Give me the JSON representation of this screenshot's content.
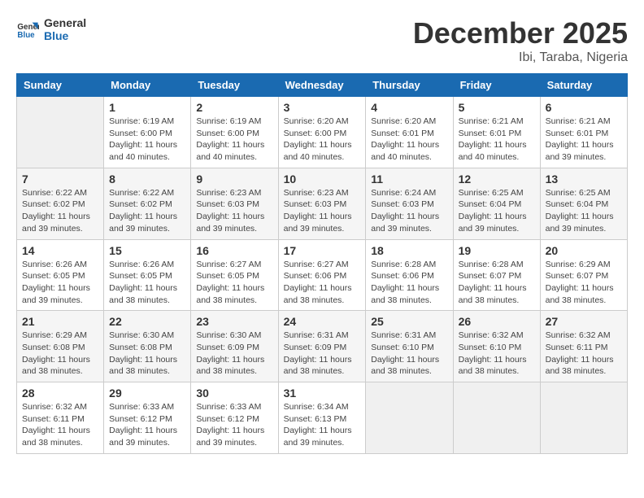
{
  "logo": {
    "line1": "General",
    "line2": "Blue"
  },
  "title": "December 2025",
  "subtitle": "Ibi, Taraba, Nigeria",
  "days_header": [
    "Sunday",
    "Monday",
    "Tuesday",
    "Wednesday",
    "Thursday",
    "Friday",
    "Saturday"
  ],
  "weeks": [
    [
      {
        "day": "",
        "info": ""
      },
      {
        "day": "1",
        "info": "Sunrise: 6:19 AM\nSunset: 6:00 PM\nDaylight: 11 hours\nand 40 minutes."
      },
      {
        "day": "2",
        "info": "Sunrise: 6:19 AM\nSunset: 6:00 PM\nDaylight: 11 hours\nand 40 minutes."
      },
      {
        "day": "3",
        "info": "Sunrise: 6:20 AM\nSunset: 6:00 PM\nDaylight: 11 hours\nand 40 minutes."
      },
      {
        "day": "4",
        "info": "Sunrise: 6:20 AM\nSunset: 6:01 PM\nDaylight: 11 hours\nand 40 minutes."
      },
      {
        "day": "5",
        "info": "Sunrise: 6:21 AM\nSunset: 6:01 PM\nDaylight: 11 hours\nand 40 minutes."
      },
      {
        "day": "6",
        "info": "Sunrise: 6:21 AM\nSunset: 6:01 PM\nDaylight: 11 hours\nand 39 minutes."
      }
    ],
    [
      {
        "day": "7",
        "info": "Sunrise: 6:22 AM\nSunset: 6:02 PM\nDaylight: 11 hours\nand 39 minutes."
      },
      {
        "day": "8",
        "info": "Sunrise: 6:22 AM\nSunset: 6:02 PM\nDaylight: 11 hours\nand 39 minutes."
      },
      {
        "day": "9",
        "info": "Sunrise: 6:23 AM\nSunset: 6:03 PM\nDaylight: 11 hours\nand 39 minutes."
      },
      {
        "day": "10",
        "info": "Sunrise: 6:23 AM\nSunset: 6:03 PM\nDaylight: 11 hours\nand 39 minutes."
      },
      {
        "day": "11",
        "info": "Sunrise: 6:24 AM\nSunset: 6:03 PM\nDaylight: 11 hours\nand 39 minutes."
      },
      {
        "day": "12",
        "info": "Sunrise: 6:25 AM\nSunset: 6:04 PM\nDaylight: 11 hours\nand 39 minutes."
      },
      {
        "day": "13",
        "info": "Sunrise: 6:25 AM\nSunset: 6:04 PM\nDaylight: 11 hours\nand 39 minutes."
      }
    ],
    [
      {
        "day": "14",
        "info": "Sunrise: 6:26 AM\nSunset: 6:05 PM\nDaylight: 11 hours\nand 39 minutes."
      },
      {
        "day": "15",
        "info": "Sunrise: 6:26 AM\nSunset: 6:05 PM\nDaylight: 11 hours\nand 38 minutes."
      },
      {
        "day": "16",
        "info": "Sunrise: 6:27 AM\nSunset: 6:05 PM\nDaylight: 11 hours\nand 38 minutes."
      },
      {
        "day": "17",
        "info": "Sunrise: 6:27 AM\nSunset: 6:06 PM\nDaylight: 11 hours\nand 38 minutes."
      },
      {
        "day": "18",
        "info": "Sunrise: 6:28 AM\nSunset: 6:06 PM\nDaylight: 11 hours\nand 38 minutes."
      },
      {
        "day": "19",
        "info": "Sunrise: 6:28 AM\nSunset: 6:07 PM\nDaylight: 11 hours\nand 38 minutes."
      },
      {
        "day": "20",
        "info": "Sunrise: 6:29 AM\nSunset: 6:07 PM\nDaylight: 11 hours\nand 38 minutes."
      }
    ],
    [
      {
        "day": "21",
        "info": "Sunrise: 6:29 AM\nSunset: 6:08 PM\nDaylight: 11 hours\nand 38 minutes."
      },
      {
        "day": "22",
        "info": "Sunrise: 6:30 AM\nSunset: 6:08 PM\nDaylight: 11 hours\nand 38 minutes."
      },
      {
        "day": "23",
        "info": "Sunrise: 6:30 AM\nSunset: 6:09 PM\nDaylight: 11 hours\nand 38 minutes."
      },
      {
        "day": "24",
        "info": "Sunrise: 6:31 AM\nSunset: 6:09 PM\nDaylight: 11 hours\nand 38 minutes."
      },
      {
        "day": "25",
        "info": "Sunrise: 6:31 AM\nSunset: 6:10 PM\nDaylight: 11 hours\nand 38 minutes."
      },
      {
        "day": "26",
        "info": "Sunrise: 6:32 AM\nSunset: 6:10 PM\nDaylight: 11 hours\nand 38 minutes."
      },
      {
        "day": "27",
        "info": "Sunrise: 6:32 AM\nSunset: 6:11 PM\nDaylight: 11 hours\nand 38 minutes."
      }
    ],
    [
      {
        "day": "28",
        "info": "Sunrise: 6:32 AM\nSunset: 6:11 PM\nDaylight: 11 hours\nand 38 minutes."
      },
      {
        "day": "29",
        "info": "Sunrise: 6:33 AM\nSunset: 6:12 PM\nDaylight: 11 hours\nand 39 minutes."
      },
      {
        "day": "30",
        "info": "Sunrise: 6:33 AM\nSunset: 6:12 PM\nDaylight: 11 hours\nand 39 minutes."
      },
      {
        "day": "31",
        "info": "Sunrise: 6:34 AM\nSunset: 6:13 PM\nDaylight: 11 hours\nand 39 minutes."
      },
      {
        "day": "",
        "info": ""
      },
      {
        "day": "",
        "info": ""
      },
      {
        "day": "",
        "info": ""
      }
    ]
  ]
}
